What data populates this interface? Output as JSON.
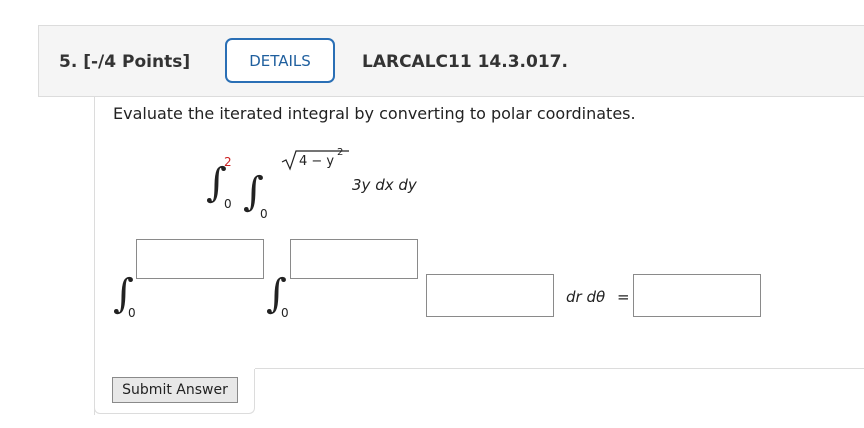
{
  "question": {
    "number": "5.",
    "points": "[-/4 Points]",
    "details_label": "DETAILS",
    "code": "LARCALC11 14.3.017."
  },
  "prompt": "Evaluate the iterated integral by converting to polar coordinates.",
  "integral": {
    "outer_lower": "0",
    "outer_upper": "2",
    "inner_lower": "0",
    "inner_upper_root": "4 − y",
    "inner_upper_exp": "2",
    "integrand": "3y dx dy"
  },
  "answer": {
    "outer_lower": "0",
    "inner_lower": "0",
    "differential": "dr dθ",
    "equals": "=",
    "outer_upper_value": "",
    "inner_upper_value": "",
    "integrand_value": "",
    "result_value": ""
  },
  "submit_label": "Submit Answer"
}
